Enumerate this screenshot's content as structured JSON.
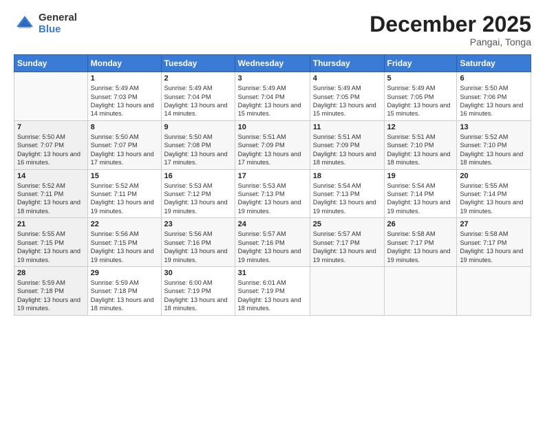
{
  "header": {
    "logo_general": "General",
    "logo_blue": "Blue",
    "month": "December 2025",
    "location": "Pangai, Tonga"
  },
  "weekdays": [
    "Sunday",
    "Monday",
    "Tuesday",
    "Wednesday",
    "Thursday",
    "Friday",
    "Saturday"
  ],
  "weeks": [
    [
      {
        "day": "",
        "content": ""
      },
      {
        "day": "1",
        "content": "Sunrise: 5:49 AM\nSunset: 7:03 PM\nDaylight: 13 hours\nand 14 minutes."
      },
      {
        "day": "2",
        "content": "Sunrise: 5:49 AM\nSunset: 7:04 PM\nDaylight: 13 hours\nand 14 minutes."
      },
      {
        "day": "3",
        "content": "Sunrise: 5:49 AM\nSunset: 7:04 PM\nDaylight: 13 hours\nand 15 minutes."
      },
      {
        "day": "4",
        "content": "Sunrise: 5:49 AM\nSunset: 7:05 PM\nDaylight: 13 hours\nand 15 minutes."
      },
      {
        "day": "5",
        "content": "Sunrise: 5:49 AM\nSunset: 7:05 PM\nDaylight: 13 hours\nand 15 minutes."
      },
      {
        "day": "6",
        "content": "Sunrise: 5:50 AM\nSunset: 7:06 PM\nDaylight: 13 hours\nand 16 minutes."
      }
    ],
    [
      {
        "day": "7",
        "content": "Sunrise: 5:50 AM\nSunset: 7:07 PM\nDaylight: 13 hours\nand 16 minutes."
      },
      {
        "day": "8",
        "content": "Sunrise: 5:50 AM\nSunset: 7:07 PM\nDaylight: 13 hours\nand 17 minutes."
      },
      {
        "day": "9",
        "content": "Sunrise: 5:50 AM\nSunset: 7:08 PM\nDaylight: 13 hours\nand 17 minutes."
      },
      {
        "day": "10",
        "content": "Sunrise: 5:51 AM\nSunset: 7:09 PM\nDaylight: 13 hours\nand 17 minutes."
      },
      {
        "day": "11",
        "content": "Sunrise: 5:51 AM\nSunset: 7:09 PM\nDaylight: 13 hours\nand 18 minutes."
      },
      {
        "day": "12",
        "content": "Sunrise: 5:51 AM\nSunset: 7:10 PM\nDaylight: 13 hours\nand 18 minutes."
      },
      {
        "day": "13",
        "content": "Sunrise: 5:52 AM\nSunset: 7:10 PM\nDaylight: 13 hours\nand 18 minutes."
      }
    ],
    [
      {
        "day": "14",
        "content": "Sunrise: 5:52 AM\nSunset: 7:11 PM\nDaylight: 13 hours\nand 18 minutes."
      },
      {
        "day": "15",
        "content": "Sunrise: 5:52 AM\nSunset: 7:11 PM\nDaylight: 13 hours\nand 19 minutes."
      },
      {
        "day": "16",
        "content": "Sunrise: 5:53 AM\nSunset: 7:12 PM\nDaylight: 13 hours\nand 19 minutes."
      },
      {
        "day": "17",
        "content": "Sunrise: 5:53 AM\nSunset: 7:13 PM\nDaylight: 13 hours\nand 19 minutes."
      },
      {
        "day": "18",
        "content": "Sunrise: 5:54 AM\nSunset: 7:13 PM\nDaylight: 13 hours\nand 19 minutes."
      },
      {
        "day": "19",
        "content": "Sunrise: 5:54 AM\nSunset: 7:14 PM\nDaylight: 13 hours\nand 19 minutes."
      },
      {
        "day": "20",
        "content": "Sunrise: 5:55 AM\nSunset: 7:14 PM\nDaylight: 13 hours\nand 19 minutes."
      }
    ],
    [
      {
        "day": "21",
        "content": "Sunrise: 5:55 AM\nSunset: 7:15 PM\nDaylight: 13 hours\nand 19 minutes."
      },
      {
        "day": "22",
        "content": "Sunrise: 5:56 AM\nSunset: 7:15 PM\nDaylight: 13 hours\nand 19 minutes."
      },
      {
        "day": "23",
        "content": "Sunrise: 5:56 AM\nSunset: 7:16 PM\nDaylight: 13 hours\nand 19 minutes."
      },
      {
        "day": "24",
        "content": "Sunrise: 5:57 AM\nSunset: 7:16 PM\nDaylight: 13 hours\nand 19 minutes."
      },
      {
        "day": "25",
        "content": "Sunrise: 5:57 AM\nSunset: 7:17 PM\nDaylight: 13 hours\nand 19 minutes."
      },
      {
        "day": "26",
        "content": "Sunrise: 5:58 AM\nSunset: 7:17 PM\nDaylight: 13 hours\nand 19 minutes."
      },
      {
        "day": "27",
        "content": "Sunrise: 5:58 AM\nSunset: 7:17 PM\nDaylight: 13 hours\nand 19 minutes."
      }
    ],
    [
      {
        "day": "28",
        "content": "Sunrise: 5:59 AM\nSunset: 7:18 PM\nDaylight: 13 hours\nand 19 minutes."
      },
      {
        "day": "29",
        "content": "Sunrise: 5:59 AM\nSunset: 7:18 PM\nDaylight: 13 hours\nand 18 minutes."
      },
      {
        "day": "30",
        "content": "Sunrise: 6:00 AM\nSunset: 7:19 PM\nDaylight: 13 hours\nand 18 minutes."
      },
      {
        "day": "31",
        "content": "Sunrise: 6:01 AM\nSunset: 7:19 PM\nDaylight: 13 hours\nand 18 minutes."
      },
      {
        "day": "",
        "content": ""
      },
      {
        "day": "",
        "content": ""
      },
      {
        "day": "",
        "content": ""
      }
    ]
  ]
}
